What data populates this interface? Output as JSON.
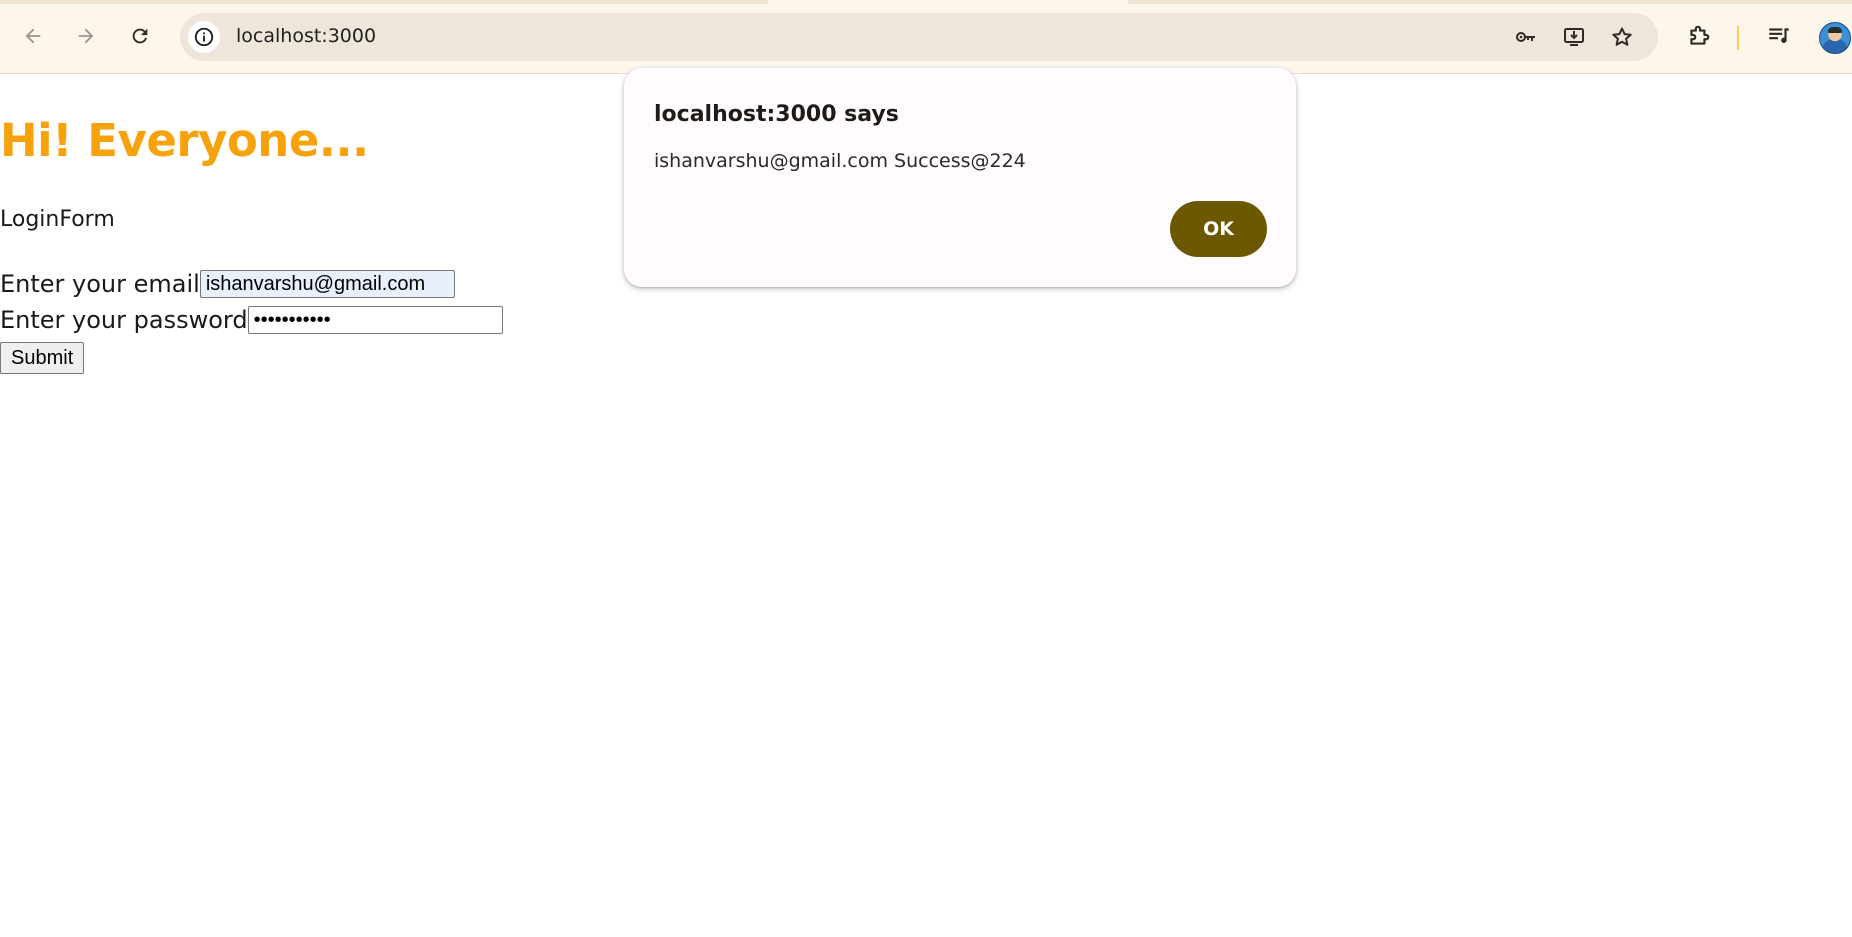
{
  "browser": {
    "url": "localhost:3000",
    "icons": {
      "back": "back-arrow-icon",
      "forward": "forward-arrow-icon",
      "reload": "reload-icon",
      "site_info": "info-icon",
      "password": "key-icon",
      "install": "install-app-icon",
      "bookmark": "star-icon",
      "extensions": "puzzle-icon",
      "reading_list": "media-list-icon",
      "profile": "avatar"
    },
    "colors": {
      "toolbar_bg": "#fdf6ea",
      "omnibox_bg": "#efe6db"
    }
  },
  "page": {
    "heading": "Hi! Everyone...",
    "form_title": "LoginForm",
    "email_label": "Enter your email",
    "email_value": "ishanvarshu@gmail.com",
    "password_label": "Enter your password",
    "password_value": "•••••••••••",
    "submit_label": "Submit",
    "colors": {
      "heading": "#f7a20b",
      "autofill_bg": "#e8f0fe"
    }
  },
  "dialog": {
    "title": "localhost:3000 says",
    "message": "ishanvarshu@gmail.com Success@224",
    "ok_label": "OK",
    "colors": {
      "ok_bg": "#6b5800",
      "dialog_bg": "#fffbfe"
    }
  }
}
